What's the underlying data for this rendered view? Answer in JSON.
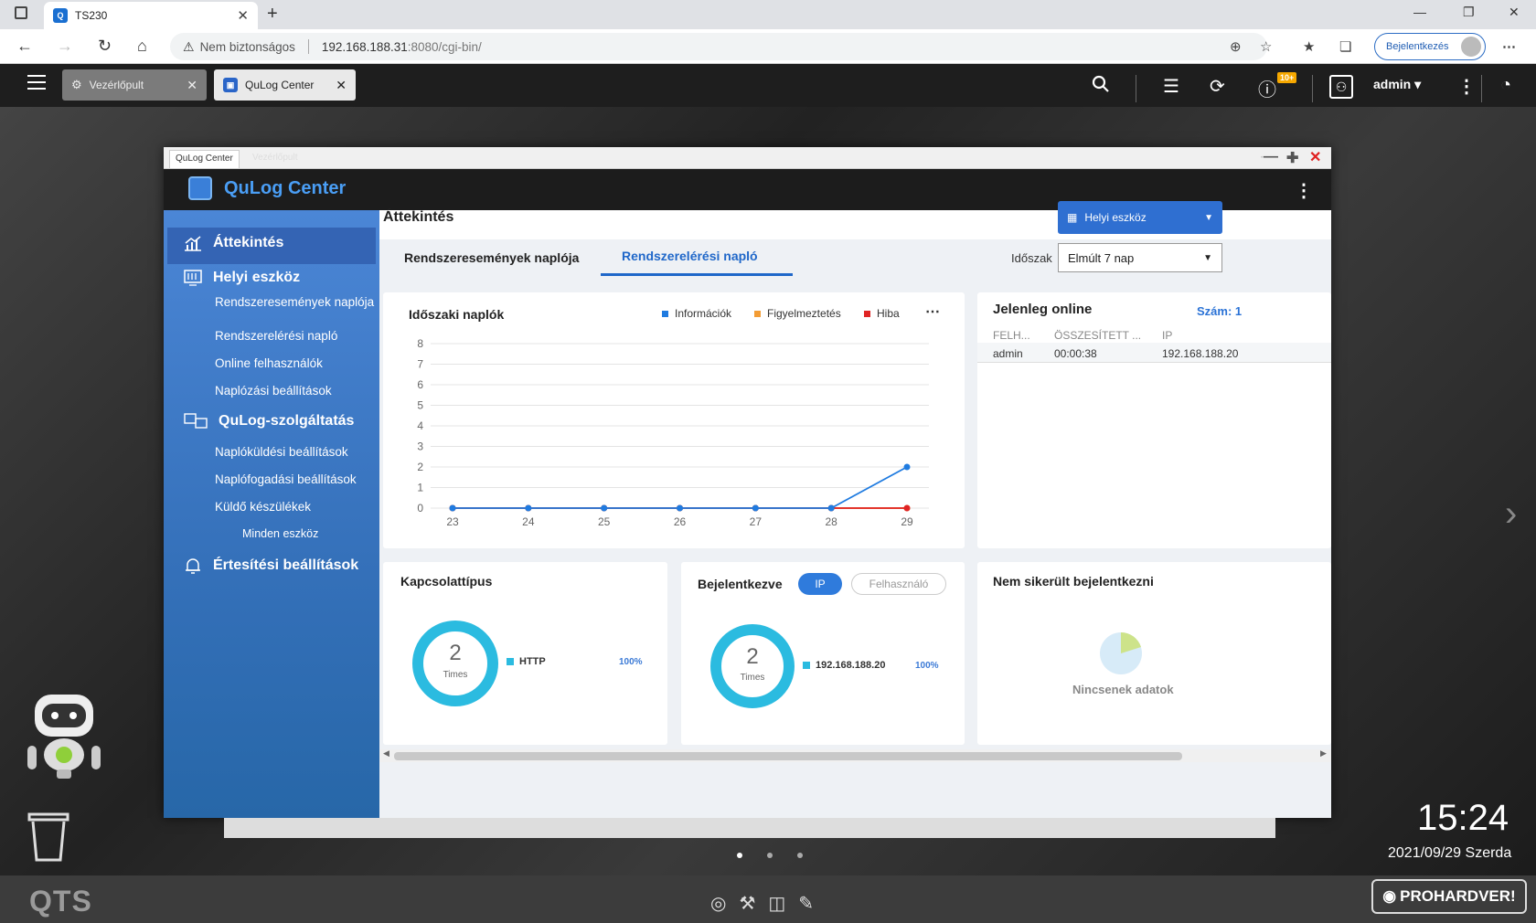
{
  "browser": {
    "tab_title": "TS230",
    "security_label": "Nem biztonságos",
    "url_host": "192.168.188.31",
    "url_rest": ":8080/cgi-bin/",
    "login_button": "Bejelentkezés"
  },
  "qts": {
    "tabs": [
      {
        "label": "Vezérlőpult"
      },
      {
        "label": "QuLog Center"
      }
    ],
    "user": "admin",
    "badge": "10+"
  },
  "window": {
    "tab_label": "QuLog Center",
    "ghost_tab": "Vezérlőpult",
    "app_title": "QuLog Center"
  },
  "sidebar": {
    "overview": "Áttekintés",
    "local_device": "Helyi eszköz",
    "sys_events": "Rendszeresemények naplója",
    "sys_access": "Rendszerelérési napló",
    "online_users": "Online felhasználók",
    "log_settings": "Naplózási beállítások",
    "qulog_service": "QuLog-szolgáltatás",
    "log_send": "Naplóküldési beállítások",
    "log_receive": "Naplófogadási beállítások",
    "sender_devices": "Küldő készülékek",
    "all_devices": "Minden eszköz",
    "notify": "Értesítési beállítások"
  },
  "main": {
    "title": "Áttekintés",
    "device_dropdown": "Helyi eszköz",
    "tabs": [
      "Rendszeresemények naplója",
      "Rendszerelérési napló"
    ],
    "period_label": "Időszak",
    "period_value": "Elmúlt 7 nap"
  },
  "periodic": {
    "title": "Időszaki naplók",
    "legend": [
      "Információk",
      "Figyelmeztetés",
      "Hiba"
    ],
    "colors": {
      "info": "#1f7be0",
      "warn": "#f39c34",
      "error": "#e02424"
    }
  },
  "chart_data": {
    "type": "line",
    "categories": [
      "23",
      "24",
      "25",
      "26",
      "27",
      "28",
      "29"
    ],
    "series": [
      {
        "name": "Információk",
        "values": [
          0,
          0,
          0,
          0,
          0,
          0,
          2
        ]
      },
      {
        "name": "Figyelmeztetés",
        "values": [
          0,
          0,
          0,
          0,
          0,
          0,
          0
        ]
      },
      {
        "name": "Hiba",
        "values": [
          0,
          0,
          0,
          0,
          0,
          0,
          0
        ]
      }
    ],
    "yticks": [
      0,
      1,
      2,
      3,
      4,
      5,
      6,
      7,
      8
    ],
    "ylim": [
      0,
      8
    ],
    "grid": true,
    "legend_position": "top-right"
  },
  "online": {
    "title": "Jelenleg online",
    "count_label": "Szám: 1",
    "columns": [
      "FELH...",
      "ÖSSZESÍTETT ...",
      "IP"
    ],
    "rows": [
      [
        "admin",
        "00:00:38",
        "192.168.188.20"
      ]
    ]
  },
  "conn": {
    "title": "Kapcsolattípus",
    "value": "2",
    "unit": "Times",
    "legend": "HTTP",
    "pct": "100%"
  },
  "logged": {
    "title": "Bejelentkezve",
    "pill_ip": "IP",
    "pill_user": "Felhasználó",
    "value": "2",
    "unit": "Times",
    "legend": "192.168.188.20",
    "pct": "100%"
  },
  "failed": {
    "title": "Nem sikerült bejelentkezni",
    "nodata": "Nincsenek adatok"
  },
  "desktop": {
    "time": "15:24",
    "date": "2021/09/29 Szerda",
    "brand": "QTS",
    "watermark": "PROHARDVER!"
  }
}
